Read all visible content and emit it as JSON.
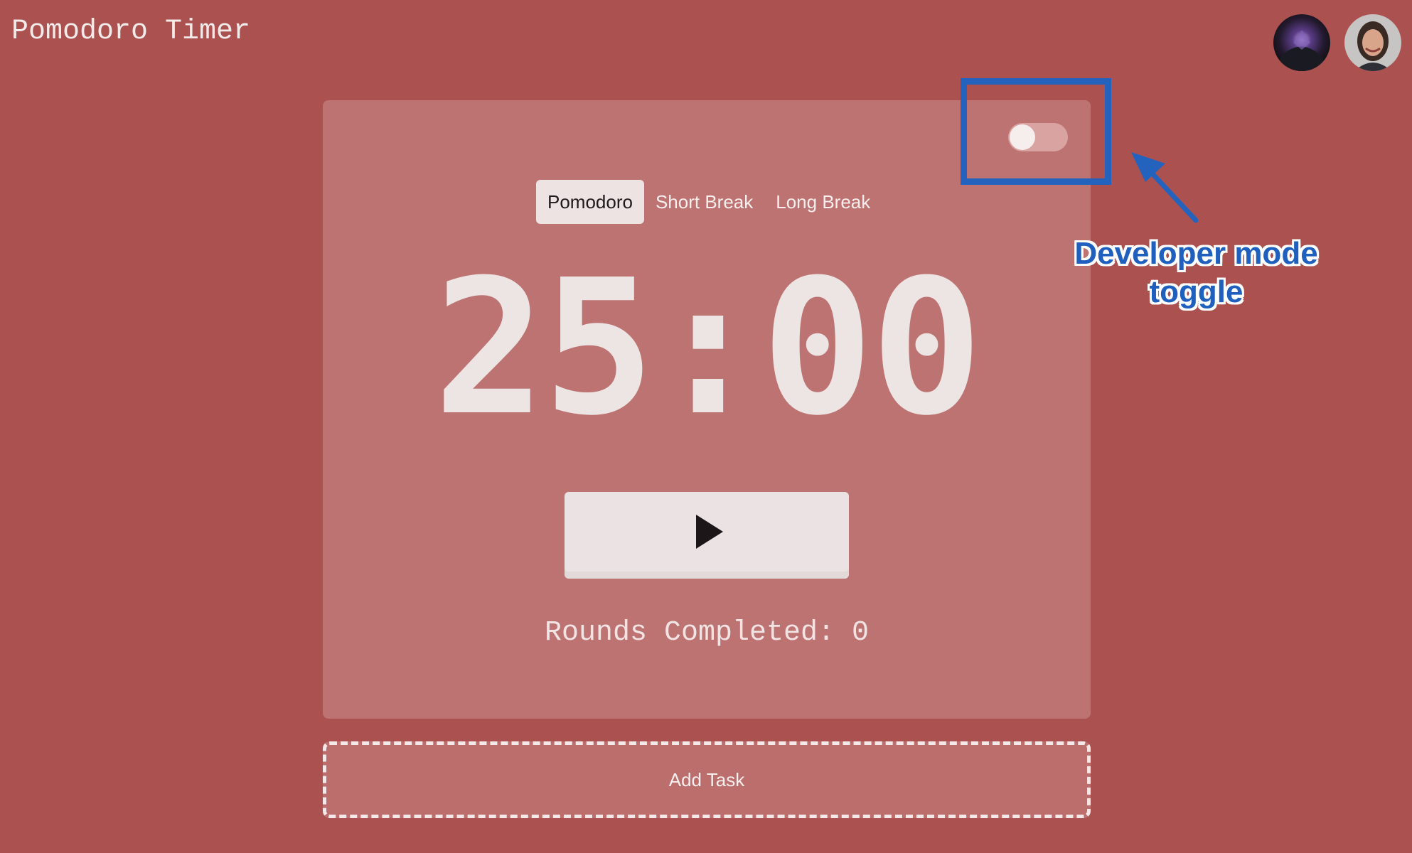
{
  "app": {
    "title": "Pomodoro Timer"
  },
  "header": {
    "avatars": [
      {
        "icon": "user-avatar-dark-icon"
      },
      {
        "icon": "user-avatar-photo-icon"
      }
    ]
  },
  "timer": {
    "modes": [
      {
        "label": "Pomodoro",
        "active": true
      },
      {
        "label": "Short Break",
        "active": false
      },
      {
        "label": "Long Break",
        "active": false
      }
    ],
    "display": "25:00",
    "play_icon": "play-icon",
    "rounds_text": "Rounds Completed: 0"
  },
  "dev_toggle": {
    "checked": false
  },
  "annotation": {
    "text_line1": "Developer mode",
    "text_line2": "toggle",
    "color": "#2363be"
  },
  "tasks": {
    "add_label": "Add Task"
  },
  "colors": {
    "background": "#ab5250",
    "card": "#bd7371",
    "accent_light": "#ede3e3"
  }
}
